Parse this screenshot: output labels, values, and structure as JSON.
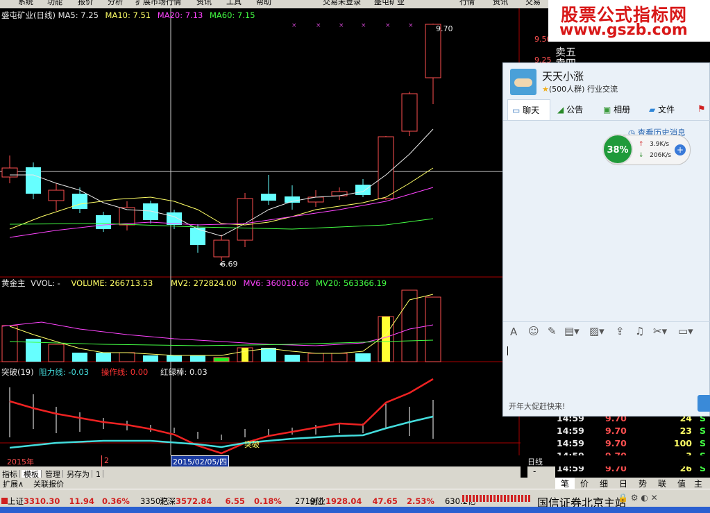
{
  "menu": {
    "items": [
      "系统",
      "功能",
      "报价",
      "分析",
      "扩展市场行情",
      "资讯",
      "工具",
      "帮助"
    ],
    "center": [
      "交易未登录",
      "盛屯矿业"
    ],
    "right": [
      "行情",
      "资讯",
      "交易"
    ]
  },
  "watermark": {
    "line1": "股票公式指标网",
    "line2": "www.gszb.com"
  },
  "main_chart": {
    "title": "盛屯矿业(日线)",
    "ma": [
      {
        "label": "MA5: 7.25",
        "color": "#e8e8e8"
      },
      {
        "label": "MA10: 7.51",
        "color": "#ffff66"
      },
      {
        "label": "MA20: 7.13",
        "color": "#ff44ff"
      },
      {
        "label": "MA60: 7.15",
        "color": "#44ff44"
      }
    ],
    "high_label": "9.70",
    "low_label": "6.69",
    "price_axis": [
      "9.50",
      "9.25"
    ]
  },
  "vol_chart": {
    "title": "黄金主",
    "items": [
      {
        "label": "VVOL: -",
        "color": "#e8e8e8"
      },
      {
        "label": "VOLUME: 266713.53",
        "color": "#ffff66"
      },
      {
        "label": "MV2: 272824.00",
        "color": "#ffff66"
      },
      {
        "label": "MV6: 360010.66",
        "color": "#ff44ff"
      },
      {
        "label": "MV20: 563366.19",
        "color": "#44ff44"
      }
    ]
  },
  "break_chart": {
    "title": "突破(19)",
    "items": [
      {
        "label": "阻力线: -0.03",
        "color": "#44dddd"
      },
      {
        "label": "操作线: 0.00",
        "color": "#ff3333"
      },
      {
        "label": "红绿棒: 0.03",
        "color": "#e8e8e8"
      }
    ],
    "annotation": "突破"
  },
  "right_panel": {
    "labels": [
      "卖五",
      "卖四"
    ]
  },
  "chat": {
    "group_name": "天天小涨",
    "group_info": "(500人群) 行业交流",
    "tabs": [
      "聊天",
      "公告",
      "相册",
      "文件"
    ],
    "history_link": "查看历史消息",
    "speed_percent": "38%",
    "up_speed": "3.9K/s",
    "down_speed": "206K/s",
    "ad_text": "开年大促赶快来!"
  },
  "ticks": [
    {
      "time": "14:59",
      "price": "9.70",
      "vol": "24",
      "flag": "S"
    },
    {
      "time": "14:59",
      "price": "9.70",
      "vol": "23",
      "flag": "S"
    },
    {
      "time": "14:59",
      "price": "9.70",
      "vol": "100",
      "flag": "S"
    },
    {
      "time": "14:59",
      "price": "9.70",
      "vol": "3",
      "flag": "S"
    },
    {
      "time": "14:59",
      "price": "9.70",
      "vol": "26",
      "flag": "S"
    }
  ],
  "timeline": {
    "year": "2015年",
    "month": "2",
    "date": "2015/02/05/四",
    "period": "日线"
  },
  "bottom_tabs": [
    "指标",
    "模板",
    "管理",
    "另存为",
    "1"
  ],
  "right_tabs": [
    "笔",
    "价",
    "细",
    "日",
    "势",
    "联",
    "值",
    "主"
  ],
  "ext_tabs": [
    "扩展∧",
    "关联报价"
  ],
  "status": {
    "sh": {
      "name": "上证",
      "value": "3310.30",
      "chg": "11.94",
      "pct": "0.36%",
      "amt": "3350亿"
    },
    "hs": {
      "name": "沪深",
      "value": "3572.84",
      "chg": "6.55",
      "pct": "0.18%",
      "amt": "2719亿"
    },
    "cy": {
      "name": "创业",
      "value": "1928.04",
      "chg": "47.65",
      "pct": "2.53%",
      "amt": "630.2亿"
    },
    "station": "国信证券北京主站"
  }
}
